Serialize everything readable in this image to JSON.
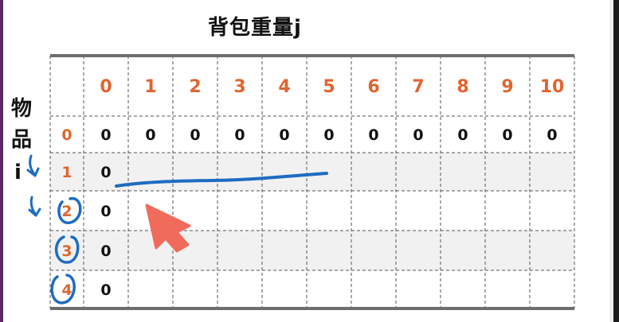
{
  "title": "背包重量j",
  "row_axis_label": [
    "物",
    "品",
    "i"
  ],
  "columns": [
    "0",
    "1",
    "2",
    "3",
    "4",
    "5",
    "6",
    "7",
    "8",
    "9",
    "10"
  ],
  "rows": [
    {
      "label": "0",
      "values": [
        "0",
        "0",
        "0",
        "0",
        "0",
        "0",
        "0",
        "0",
        "0",
        "0",
        "0"
      ]
    },
    {
      "label": "1",
      "values": [
        "0",
        "",
        "",
        "",
        "",
        "",
        "",
        "",
        "",
        "",
        ""
      ]
    },
    {
      "label": "2",
      "values": [
        "0",
        "",
        "",
        "",
        "",
        "",
        "",
        "",
        "",
        "",
        ""
      ]
    },
    {
      "label": "3",
      "values": [
        "0",
        "",
        "",
        "",
        "",
        "",
        "",
        "",
        "",
        "",
        ""
      ]
    },
    {
      "label": "4",
      "values": [
        "0",
        "",
        "",
        "",
        "",
        "",
        "",
        "",
        "",
        "",
        ""
      ]
    }
  ],
  "colors": {
    "header_text": "#e0652e",
    "annotation_ink": "#1d6cc1",
    "pointer_arrow": "#f06b5b",
    "shaded_row": "#f1f1f1"
  }
}
